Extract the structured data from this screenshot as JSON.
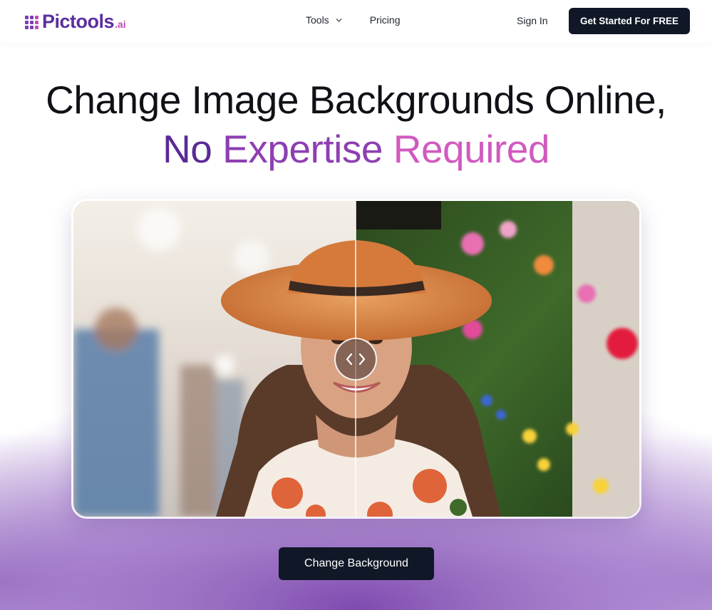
{
  "header": {
    "logo_text": "Pictools",
    "logo_suffix": ".ai",
    "nav": {
      "tools_label": "Tools",
      "pricing_label": "Pricing"
    },
    "sign_in_label": "Sign In",
    "cta_label": "Get Started For FREE"
  },
  "hero": {
    "title_line1": "Change Image Backgrounds Online,",
    "title_line2_word1": "No",
    "title_line2_word2": "Expertise",
    "title_line2_word3": "Required"
  },
  "compare": {
    "icon_left": "chevron-left-icon",
    "icon_right": "chevron-right-icon"
  },
  "main_cta_label": "Change Background",
  "colors": {
    "brand_dark": "#101827",
    "brand_purple": "#5b2f9e",
    "brand_pink": "#c24bb3",
    "gradient_start": "#5a2a96",
    "gradient_end": "#d05abf"
  }
}
